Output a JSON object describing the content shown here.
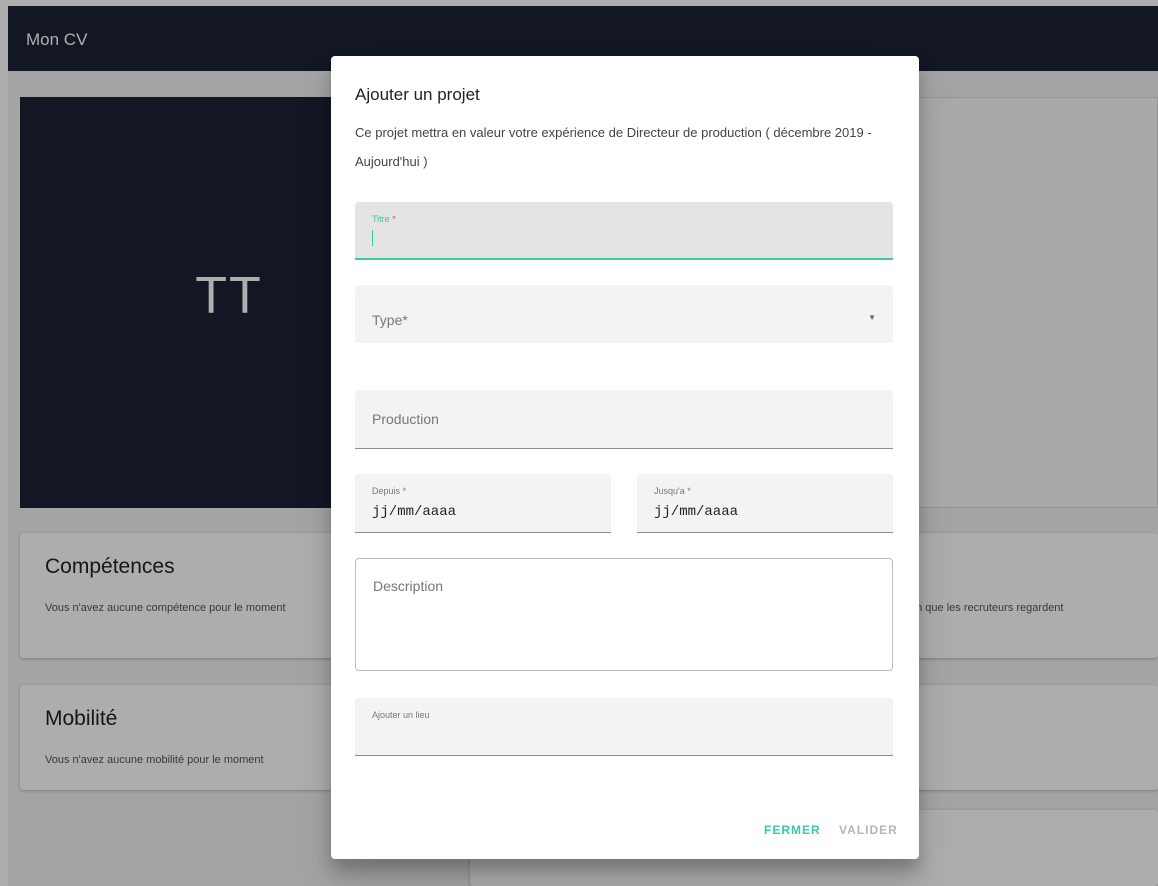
{
  "app": {
    "title": "Mon CV"
  },
  "profile": {
    "initials": "TT"
  },
  "sections": {
    "competences": {
      "title": "Compétences",
      "text": "Vous n'avez aucune compétence pour le moment",
      "text_right": "on que les recruteurs regardent"
    },
    "mobilite": {
      "title": "Mobilité",
      "text": "Vous n'avez aucune mobilité pour le moment"
    }
  },
  "dialog": {
    "title": "Ajouter un projet",
    "description": "Ce projet mettra en valeur votre expérience de Directeur de production ( décembre 2019 - Aujourd'hui )",
    "fields": {
      "titre": {
        "label": "Titre",
        "required_mark": "*",
        "value": ""
      },
      "type": {
        "label": "Type*",
        "value": ""
      },
      "production": {
        "label": "Production",
        "value": ""
      },
      "depuis": {
        "label": "Depuis *",
        "value": "jj/mm/aaaa"
      },
      "jusqua": {
        "label": "Jusqu'a *",
        "value": "jj/mm/aaaa"
      },
      "description": {
        "label": "Description",
        "value": ""
      },
      "lieu": {
        "label": "Ajouter un lieu",
        "value": ""
      }
    },
    "actions": {
      "close_label": "FERMER",
      "submit_label": "VALIDER"
    }
  },
  "colors": {
    "appbar": "#1b2234",
    "accent": "#3cc8a7",
    "required": "#e04646",
    "disabled": "#b5b5b5"
  }
}
